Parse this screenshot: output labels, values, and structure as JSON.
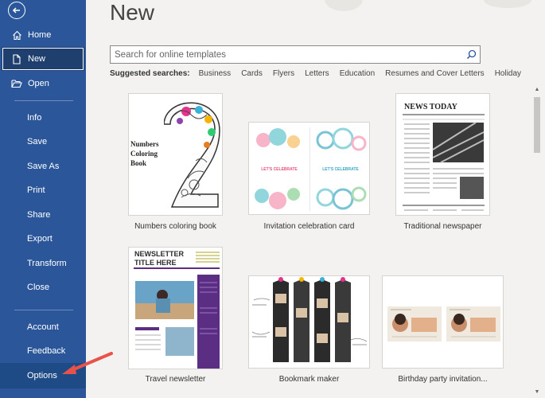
{
  "sidebar": {
    "items": [
      {
        "label": "Home",
        "icon": "home-icon"
      },
      {
        "label": "New",
        "icon": "new-document-icon"
      },
      {
        "label": "Open",
        "icon": "folder-open-icon"
      },
      {
        "label": "Info"
      },
      {
        "label": "Save"
      },
      {
        "label": "Save As"
      },
      {
        "label": "Print"
      },
      {
        "label": "Share"
      },
      {
        "label": "Export"
      },
      {
        "label": "Transform"
      },
      {
        "label": "Close"
      },
      {
        "label": "Account"
      },
      {
        "label": "Feedback"
      },
      {
        "label": "Options"
      }
    ]
  },
  "main": {
    "title": "New",
    "search": {
      "placeholder": "Search for online templates"
    },
    "suggested": {
      "label": "Suggested searches:",
      "links": [
        "Business",
        "Cards",
        "Flyers",
        "Letters",
        "Education",
        "Resumes and Cover Letters",
        "Holiday"
      ]
    },
    "templates": [
      {
        "caption": "Numbers coloring book",
        "thumb_text": "Numbers Coloring Book"
      },
      {
        "caption": "Invitation celebration card",
        "thumb_text": "LET'S CELEBRATE"
      },
      {
        "caption": "Traditional newspaper",
        "thumb_text": "NEWS TODAY"
      },
      {
        "caption": "Travel newsletter",
        "thumb_text": "NEWSLETTER TITLE HERE"
      },
      {
        "caption": "Bookmark maker"
      },
      {
        "caption": "Birthday party invitation..."
      }
    ]
  },
  "colors": {
    "sidebar": "#2b579a",
    "accent_arrow": "#e8524a"
  }
}
